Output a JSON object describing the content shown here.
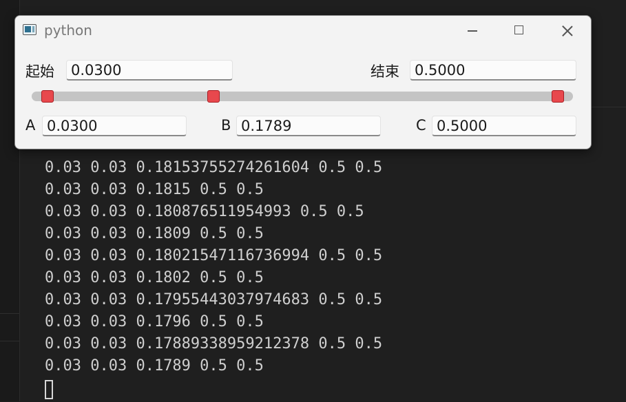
{
  "window": {
    "title": "python",
    "icon": "python-window-icon",
    "controls": {
      "minimize": "minimize-icon",
      "maximize": "maximize-icon",
      "close": "close-icon"
    }
  },
  "range": {
    "start_label": "起始",
    "start_value": "0.0300",
    "end_label": "结束",
    "end_value": "0.5000"
  },
  "slider": {
    "min": 0.03,
    "max": 0.5,
    "handles": [
      0.03,
      0.1789,
      0.5
    ],
    "handle_color": "#e8484d",
    "track_color": "#c4c4c4"
  },
  "params": {
    "a_label": "A",
    "a_value": "0.0300",
    "b_label": "B",
    "b_value": "0.1789",
    "c_label": "C",
    "c_value": "0.5000"
  },
  "terminal": {
    "lines": [
      "0.03 0.03 0.18153755274261604 0.5 0.5",
      "0.03 0.03 0.1815 0.5 0.5",
      "0.03 0.03 0.180876511954993 0.5 0.5",
      "0.03 0.03 0.1809 0.5 0.5",
      "0.03 0.03 0.18021547116736994 0.5 0.5",
      "0.03 0.03 0.1802 0.5 0.5",
      "0.03 0.03 0.17955443037974683 0.5 0.5",
      "0.03 0.03 0.1796 0.5 0.5",
      "0.03 0.03 0.17889338959212378 0.5 0.5",
      "0.03 0.03 0.1789 0.5 0.5"
    ]
  }
}
